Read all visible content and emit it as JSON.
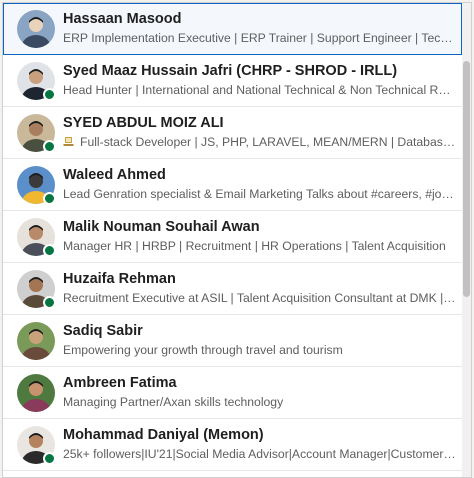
{
  "suggestions": [
    {
      "name": "Hassaan Masood",
      "headline": "ERP Implementation Executive | ERP Trainer | Support Engineer | Technical Trainer",
      "online": false,
      "highlighted": true,
      "avatar_colors": [
        "#8aa4c4",
        "#3a4a63",
        "#e8d3bd"
      ]
    },
    {
      "name": "Syed Maaz Hussain Jafri (CHRP - SHROD - IRLL)",
      "headline": "Head Hunter | International and National Technical & Non Technical Recruiter",
      "online": true,
      "highlighted": false,
      "avatar_colors": [
        "#dfe3e8",
        "#1e2430",
        "#c9a07e"
      ]
    },
    {
      "name": "SYED ABDUL MOIZ ALI",
      "headline_emoji": "laptop-emoji",
      "headline": "Full-stack Developer | JS, PHP, LARAVEL, MEAN/MERN | Database Expert",
      "online": true,
      "highlighted": false,
      "avatar_colors": [
        "#c9b89a",
        "#4a5040",
        "#a87e5e"
      ]
    },
    {
      "name": "Waleed Ahmed",
      "headline": "Lead Genration specialist & Email Marketing Talks about #careers, #jobsearch",
      "online": true,
      "highlighted": false,
      "avatar_colors": [
        "#5b8fc9",
        "#f0b830",
        "#3a3a3a"
      ]
    },
    {
      "name": "Malik Nouman Souhail Awan",
      "headline": "Manager HR | HRBP | Recruitment | HR Operations | Talent Acquisition",
      "online": true,
      "highlighted": false,
      "avatar_colors": [
        "#e6e1da",
        "#4a4f5a",
        "#b88a6a"
      ]
    },
    {
      "name": "Huzaifa Rehman",
      "headline": "Recruitment Executive at ASIL | Talent Acquisition Consultant at DMK | Marketing",
      "online": true,
      "highlighted": false,
      "avatar_colors": [
        "#cfcfcf",
        "#5a4a3a",
        "#a37552"
      ]
    },
    {
      "name": "Sadiq Sabir",
      "headline": "Empowering your growth through travel and tourism",
      "online": false,
      "highlighted": false,
      "avatar_colors": [
        "#7a9a5a",
        "#6a4a3a",
        "#c9a27a"
      ]
    },
    {
      "name": "Ambreen Fatima",
      "headline": "Managing Partner/Axan skills technology",
      "online": false,
      "highlighted": false,
      "avatar_colors": [
        "#4f7a3f",
        "#8a3a5a",
        "#c7936f"
      ]
    },
    {
      "name": "Mohammad Daniyal (Memon)",
      "headline": "25k+ followers|IU'21|Social Media Advisor|Account Manager|Customer support",
      "online": true,
      "highlighted": false,
      "avatar_colors": [
        "#e9e6e2",
        "#2a2a2a",
        "#b5825e"
      ]
    }
  ],
  "colors": {
    "online": "#057642",
    "highlight_border": "#0a66c2"
  }
}
